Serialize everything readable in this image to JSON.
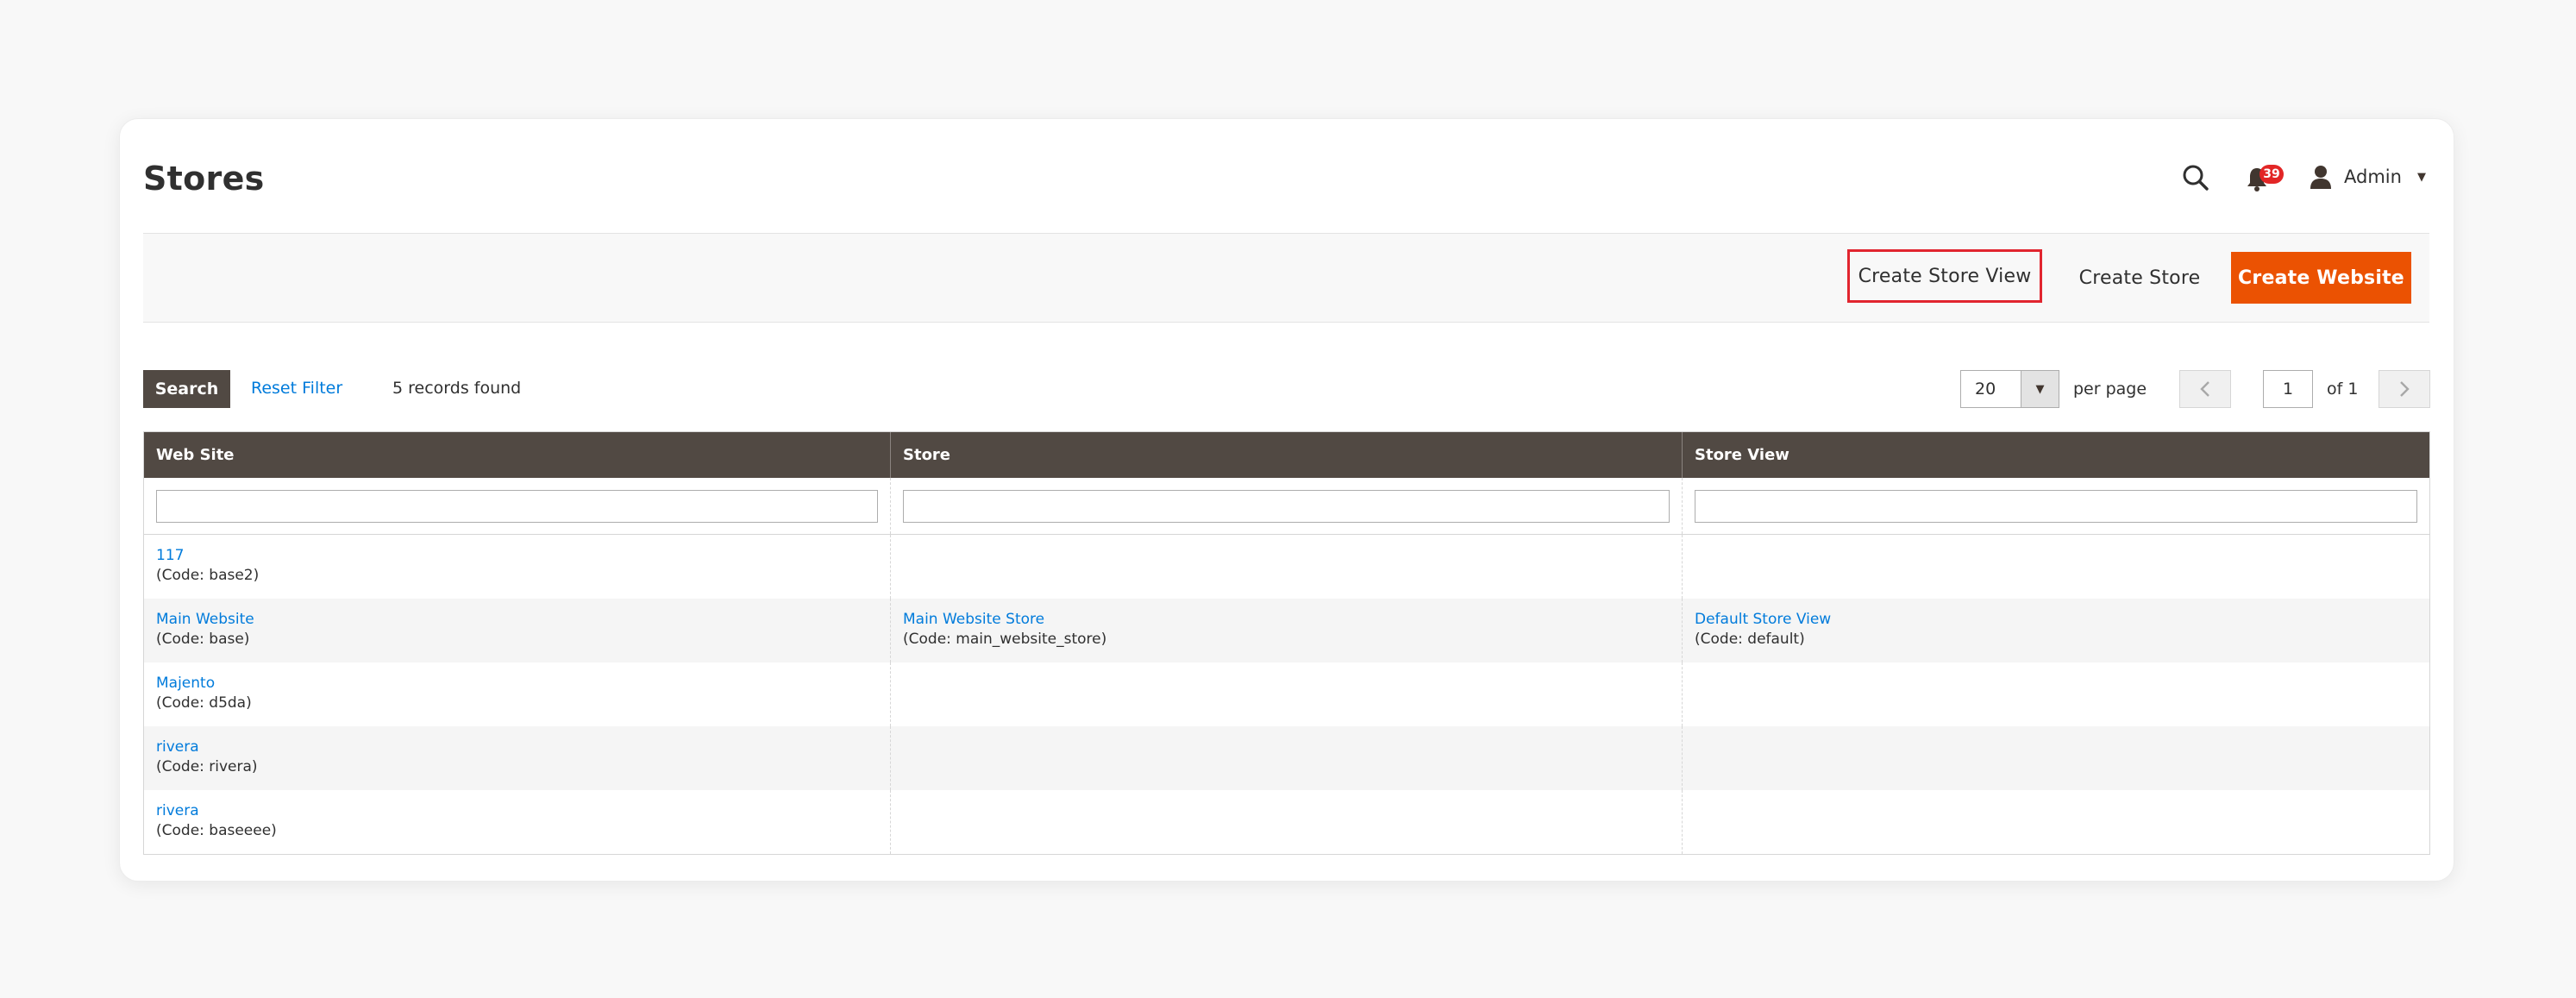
{
  "header": {
    "title": "Stores",
    "notifications_count": "39",
    "user_label": "Admin"
  },
  "actions": {
    "create_store_view": "Create Store View",
    "create_store": "Create Store",
    "create_website": "Create Website"
  },
  "toolbar": {
    "search_label": "Search",
    "reset_filter_label": "Reset Filter",
    "records_found": "5 records found",
    "per_page_value": "20",
    "per_page_label": "per page",
    "current_page": "1",
    "of_pages": "of 1"
  },
  "grid": {
    "columns": [
      "Web Site",
      "Store",
      "Store View"
    ],
    "rows": [
      {
        "website": "117",
        "website_code": "(Code: base2)",
        "store": "",
        "store_code": "",
        "store_view": "",
        "store_view_code": ""
      },
      {
        "website": "Main Website",
        "website_code": "(Code: base)",
        "store": "Main Website Store",
        "store_code": "(Code: main_website_store)",
        "store_view": "Default Store View",
        "store_view_code": "(Code: default)"
      },
      {
        "website": "Majento",
        "website_code": "(Code: d5da)",
        "store": "",
        "store_code": "",
        "store_view": "",
        "store_view_code": ""
      },
      {
        "website": "rivera",
        "website_code": "(Code: rivera)",
        "store": "",
        "store_code": "",
        "store_view": "",
        "store_view_code": ""
      },
      {
        "website": "rivera",
        "website_code": "(Code: baseeee)",
        "store": "",
        "store_code": "",
        "store_view": "",
        "store_view_code": ""
      }
    ]
  },
  "colors": {
    "accent": "#eb5202",
    "header_bg": "#514943",
    "link": "#007bdb",
    "highlight": "#e1252f",
    "badge": "#e22626"
  },
  "icons": [
    "search-icon",
    "bell-icon",
    "user-icon",
    "chevron-left-icon",
    "chevron-right-icon",
    "caret-down-icon"
  ]
}
